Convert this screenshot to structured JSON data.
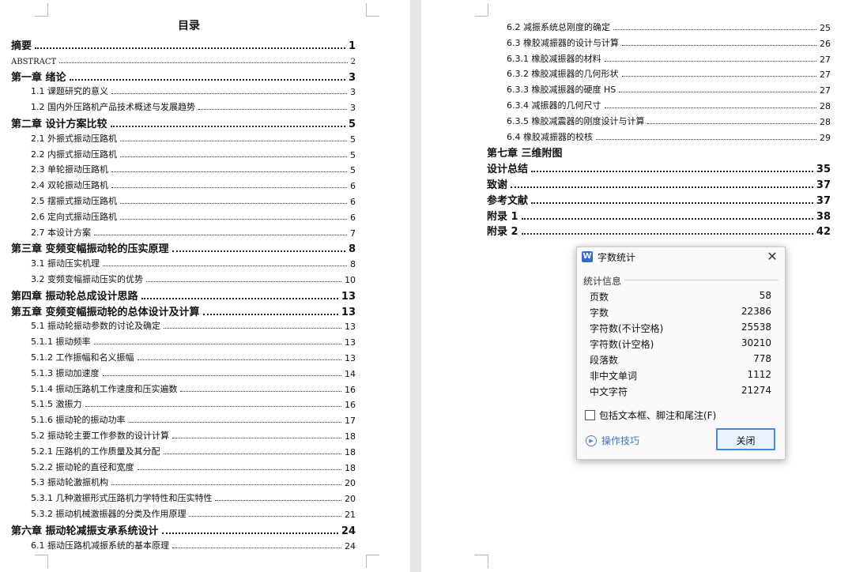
{
  "left_page": {
    "title": "目录",
    "entries": [
      {
        "text": "摘要",
        "page": "1"
      },
      {
        "text": "ABSTRACT",
        "page": "2"
      },
      {
        "text": "第一章  绪论",
        "page": "3"
      },
      {
        "text": "1.1  课题研究的意义",
        "page": "3"
      },
      {
        "text": "1.2  国内外压路机产品技术概述与发展趋势",
        "page": "3"
      },
      {
        "text": "第二章  设计方案比较",
        "page": "5"
      },
      {
        "text": "2.1  外振式振动压路机",
        "page": "5"
      },
      {
        "text": "2.2  内振式振动压路机",
        "page": "5"
      },
      {
        "text": "2.3  单轮振动压路机",
        "page": "5"
      },
      {
        "text": "2.4  双轮振动压路机",
        "page": "6"
      },
      {
        "text": "2.5  摆振式振动压路机",
        "page": "6"
      },
      {
        "text": "2.6  定向式振动压路机",
        "page": "6"
      },
      {
        "text": "2.7  本设计方案",
        "page": "7"
      },
      {
        "text": "第三章  变频变幅振动轮的压实原理",
        "page": "8"
      },
      {
        "text": "3.1  振动压实机理",
        "page": "8"
      },
      {
        "text": "3.2  变频变幅振动压实的优势",
        "page": "10"
      },
      {
        "text": "第四章  振动轮总成设计思路",
        "page": "13"
      },
      {
        "text": "第五章  变频变幅振动轮的总体设计及计算",
        "page": "13"
      },
      {
        "text": "5.1  振动轮振动参数的讨论及确定",
        "page": "13"
      },
      {
        "text": "5.1.1  振动频率",
        "page": "13"
      },
      {
        "text": "5.1.2  工作振幅和名义振幅",
        "page": "13"
      },
      {
        "text": "5.1.3  振动加速度",
        "page": "14"
      },
      {
        "text": "5.1.4  振动压路机工作速度和压实遍数",
        "page": "16"
      },
      {
        "text": "5.1.5  激振力",
        "page": "16"
      },
      {
        "text": "5.1.6  振动轮的振动功率",
        "page": "17"
      },
      {
        "text": "5.2  振动轮主要工作参数的设计计算",
        "page": "18"
      },
      {
        "text": "5.2.1  压路机的工作质量及其分配",
        "page": "18"
      },
      {
        "text": "5.2.2  振动轮的直径和宽度",
        "page": "18"
      },
      {
        "text": "5.3  振动轮激振机构",
        "page": "20"
      },
      {
        "text": "5.3.1  几种激振形式压路机力学特性和压实特性",
        "page": "20"
      },
      {
        "text": "5.3.2  振动机械激振器的分类及作用原理",
        "page": "21"
      },
      {
        "text": "第六章  振动轮减振支承系统设计",
        "page": "24"
      },
      {
        "text": "6.1  振动压路机减振系统的基本原理",
        "page": "24"
      }
    ]
  },
  "right_page": {
    "entries": [
      {
        "text": "6.2  减振系统总刚度的确定",
        "page": "25"
      },
      {
        "text": "6.3  橡胶减振器的设计与计算",
        "page": "26"
      },
      {
        "text": "6.3.1  橡胶减振器的材料",
        "page": "27"
      },
      {
        "text": "6.3.2  橡胶减振器的几何形状",
        "page": "27"
      },
      {
        "text": "6.3.3  橡胶减振器的硬度 HS",
        "page": "27"
      },
      {
        "text": "6.3.4  减振器的几何尺寸",
        "page": "28"
      },
      {
        "text": "6.3.5  橡胶减震器的刚度设计与计算",
        "page": "28"
      },
      {
        "text": "6.4  橡胶减振器的校核",
        "page": "29"
      },
      {
        "text": "第七章  三维附图",
        "page": ""
      },
      {
        "text": "设计总结",
        "page": "35"
      },
      {
        "text": "致谢",
        "page": "37"
      },
      {
        "text": "参考文献",
        "page": "37"
      },
      {
        "text": "附录 1",
        "page": "38"
      },
      {
        "text": "附录 2",
        "page": "42"
      }
    ]
  },
  "dialog": {
    "app_icon": "W",
    "title": "字数统计",
    "close_glyph": "✕",
    "group_label": "统计信息",
    "stats": [
      {
        "label": "页数",
        "value": "58"
      },
      {
        "label": "字数",
        "value": "22386"
      },
      {
        "label": "字符数(不计空格)",
        "value": "25538"
      },
      {
        "label": "字符数(计空格)",
        "value": "30210"
      },
      {
        "label": "段落数",
        "value": "778"
      },
      {
        "label": "非中文单词",
        "value": "1112"
      },
      {
        "label": "中文字符",
        "value": "21274"
      }
    ],
    "checkbox_label": "包括文本框、脚注和尾注(F)",
    "checkbox_checked": false,
    "tips_icon": "play-circle-icon",
    "tips_label": "操作技巧",
    "close_button": "关闭"
  },
  "colors": {
    "accent": "#4a86d6",
    "link": "#3b74c9",
    "page_bg": "#ffffff",
    "workspace": "#e6e6e6"
  }
}
